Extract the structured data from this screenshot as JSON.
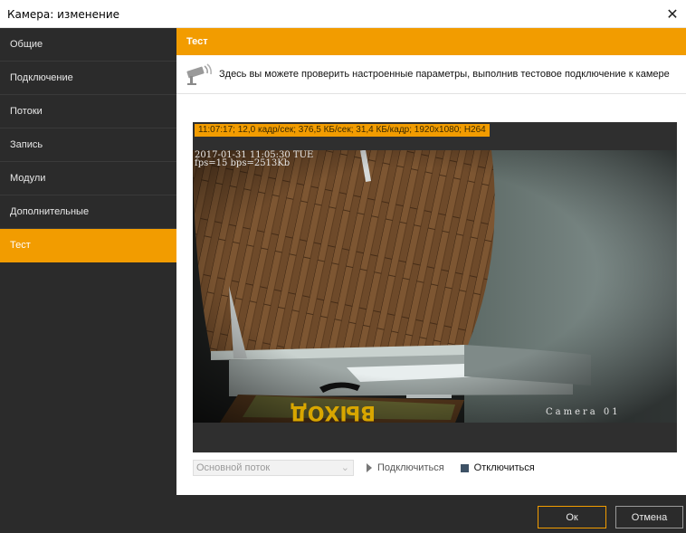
{
  "window": {
    "title": "Камера: изменение",
    "close_glyph": "✕"
  },
  "sidebar": {
    "items": [
      {
        "label": "Общие",
        "active": false
      },
      {
        "label": "Подключение",
        "active": false
      },
      {
        "label": "Потоки",
        "active": false
      },
      {
        "label": "Запись",
        "active": false
      },
      {
        "label": "Модули",
        "active": false
      },
      {
        "label": "Дополнительные",
        "active": false
      },
      {
        "label": "Тест",
        "active": true
      }
    ]
  },
  "content": {
    "header": "Тест",
    "info_icon": "security-camera-icon",
    "info_text": "Здесь вы можете проверить настроенные параметры, выполнив тестовое подключение к камере"
  },
  "video": {
    "stats": "11:07:17; 12,0 кадр/сек; 376,5 КБ/сек; 31,4 КБ/кадр; 1920x1080; H264",
    "osd_datetime": "2017-01-31 11:05:30 TUE",
    "osd_bitrate": "fps=15 bps=2513Kb",
    "osd_camera": "Camera 01",
    "sign_text": "ВЫХОД"
  },
  "controls": {
    "stream_select": "Основной поток",
    "connect_label": "Подключиться",
    "disconnect_label": "Отключиться"
  },
  "footer": {
    "ok_label": "Ок",
    "cancel_label": "Отмена"
  },
  "colors": {
    "accent": "#f29c00",
    "sidebar_bg": "#2b2b2b"
  }
}
